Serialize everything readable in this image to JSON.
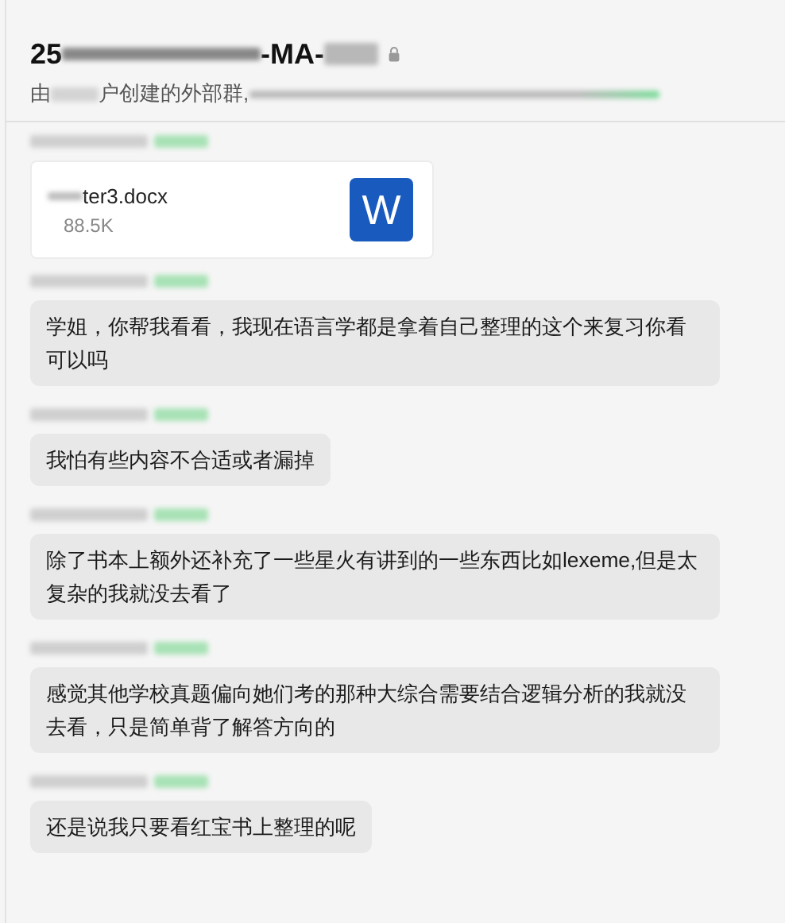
{
  "header": {
    "title": [
      {
        "kind": "text",
        "text": "25"
      },
      {
        "kind": "blur"
      },
      {
        "kind": "text",
        "text": "-MA-"
      },
      {
        "kind": "blur"
      }
    ],
    "subtitle": [
      {
        "kind": "text",
        "text": "由"
      },
      {
        "kind": "blur"
      },
      {
        "kind": "text",
        "text": "户创建的外部群,"
      },
      {
        "kind": "blur"
      }
    ]
  },
  "messages": [
    {
      "kind": "file",
      "file_name": "ter3.docx",
      "file_size": "88.5K",
      "icon_letter": "W"
    },
    {
      "kind": "text",
      "text": "学姐，你帮我看看，我现在语言学都是拿着自己整理的这个来复习你看可以吗"
    },
    {
      "kind": "text",
      "text": "我怕有些内容不合适或者漏掉"
    },
    {
      "kind": "text",
      "text": "除了书本上额外还补充了一些星火有讲到的一些东西比如lexeme,但是太复杂的我就没去看了"
    },
    {
      "kind": "text",
      "text": "感觉其他学校真题偏向她们考的那种大综合需要结合逻辑分析的我就没去看，只是简单背了解答方向的"
    },
    {
      "kind": "text",
      "text": "还是说我只要看红宝书上整理的呢"
    }
  ]
}
